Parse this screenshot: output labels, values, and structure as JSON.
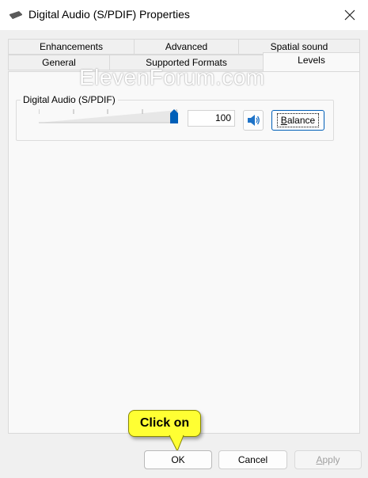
{
  "window": {
    "title": "Digital Audio (S/PDIF) Properties"
  },
  "tabs": {
    "row1": [
      {
        "label": "Enhancements"
      },
      {
        "label": "Advanced"
      },
      {
        "label": "Spatial sound"
      }
    ],
    "row2": [
      {
        "label": "General"
      },
      {
        "label": "Supported Formats"
      },
      {
        "label": "Levels"
      }
    ],
    "active": "Levels"
  },
  "watermark": "ElevenForum.com",
  "levels": {
    "group_label": "Digital Audio (S/PDIF)",
    "volume_value": "100",
    "volume_level_percent": 100,
    "balance_label_prefix": "B",
    "balance_label_rest": "alance"
  },
  "callout": {
    "text": "Click on"
  },
  "buttons": {
    "ok": "OK",
    "cancel": "Cancel",
    "apply_prefix": "A",
    "apply_rest": "pply"
  },
  "colors": {
    "accent": "#005fb8",
    "callout_bg": "#ffff33"
  },
  "icons": {
    "title": "sound-device-icon",
    "close": "close-icon",
    "speaker": "speaker-icon"
  }
}
